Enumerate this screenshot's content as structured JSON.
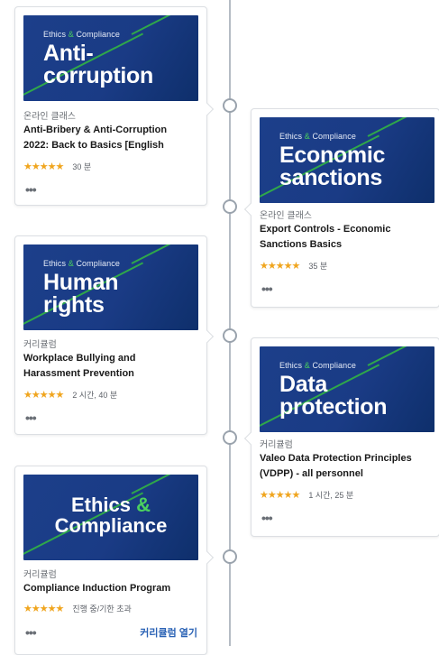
{
  "cards": [
    {
      "eyebrow_pre": "Ethics",
      "eyebrow_amp": "&",
      "eyebrow_post": "Compliance",
      "thumb_line1": "Anti-",
      "thumb_line2": "corruption",
      "type": "온라인 클래스",
      "title_line1": "Anti-Bribery & Anti-Corruption",
      "title_line2": "2022: Back to Basics [English",
      "stars": "★★★★★",
      "rating": 4.5,
      "duration": "30 분",
      "more": "•••"
    },
    {
      "eyebrow_pre": "Ethics",
      "eyebrow_amp": "&",
      "eyebrow_post": "Compliance",
      "thumb_line1": "Economic",
      "thumb_line2": "sanctions",
      "type": "온라인 클래스",
      "title_line1": "Export Controls - Economic",
      "title_line2": "Sanctions Basics",
      "stars": "★★★★★",
      "rating": 4.5,
      "duration": "35 분",
      "more": "•••"
    },
    {
      "eyebrow_pre": "Ethics",
      "eyebrow_amp": "&",
      "eyebrow_post": "Compliance",
      "thumb_line1": "Human",
      "thumb_line2": "rights",
      "type": "커리큘럼",
      "title_line1": "Workplace Bullying and",
      "title_line2": "Harassment Prevention",
      "stars": "★★★★★",
      "rating": 4.5,
      "duration": "2 시간, 40 분",
      "more": "•••"
    },
    {
      "eyebrow_pre": "Ethics",
      "eyebrow_amp": "&",
      "eyebrow_post": "Compliance",
      "thumb_line1": "Data",
      "thumb_line2": "protection",
      "type": "커리큘럼",
      "title_line1": "Valeo Data Protection Principles",
      "title_line2": "(VDPP) - all personnel",
      "stars": "★★★★★",
      "rating": 4.5,
      "duration": "1 시간, 25 분",
      "more": "•••"
    },
    {
      "thumb_line1_pre": "Ethics",
      "thumb_line1_amp": "&",
      "thumb_line2": "Compliance",
      "type": "커리큘럼",
      "title_line1": "Compliance Induction Program",
      "stars": "★★★★★",
      "rating": 4.5,
      "duration": "진행 중/기한 초과",
      "more": "•••",
      "open_label": "커리큘럼 열기"
    }
  ],
  "colors": {
    "thumb_bg": "#1c3f8a",
    "accent_green": "#4bd15f",
    "star": "#f0a51e",
    "link": "#2a62b5"
  }
}
